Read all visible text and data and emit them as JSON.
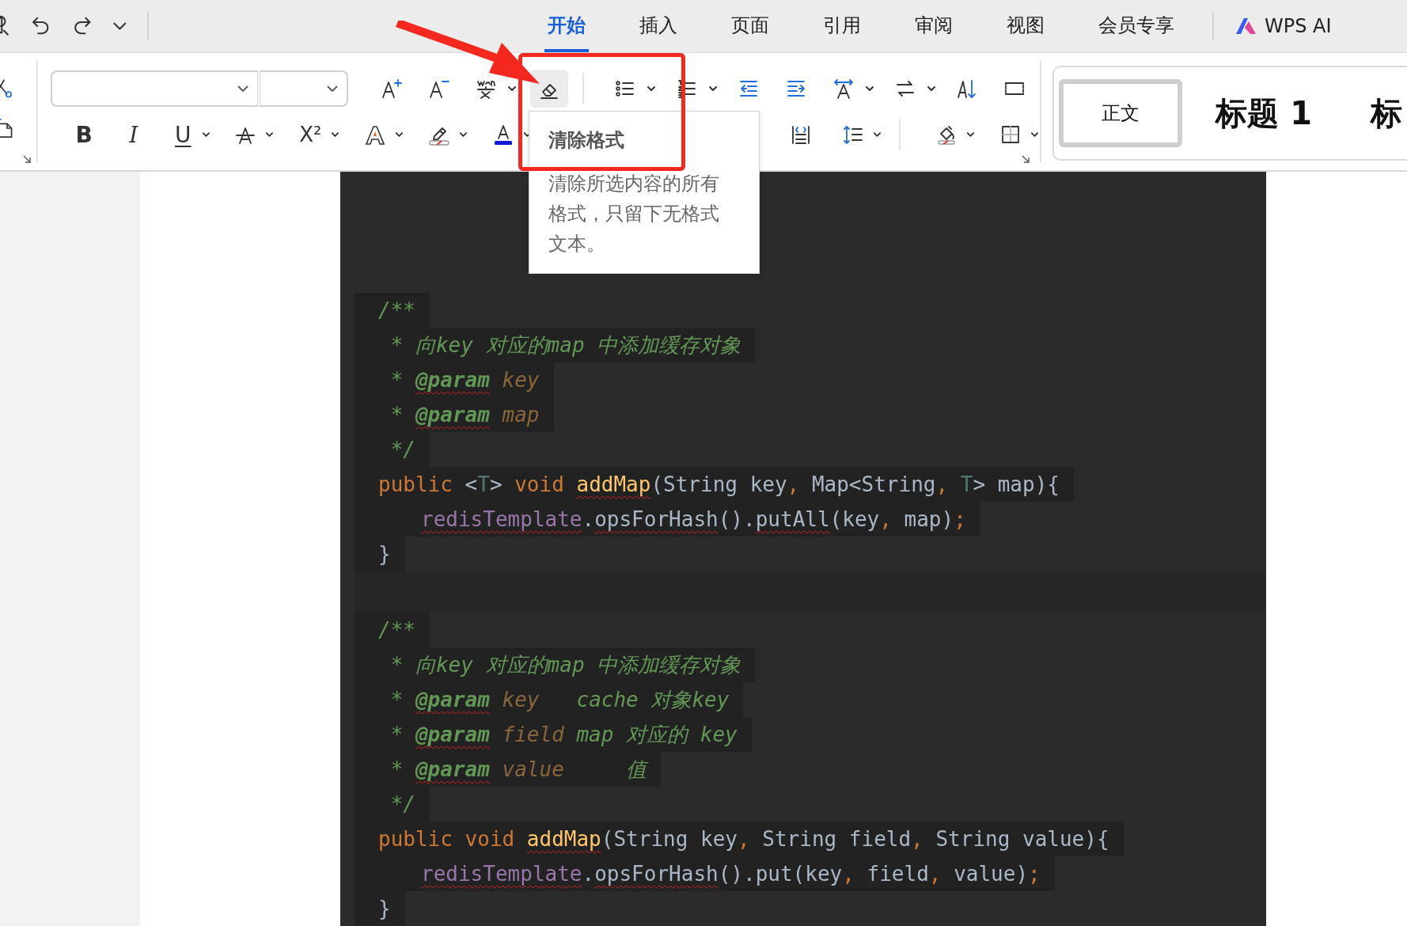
{
  "toolbar": {
    "tabs": [
      {
        "label": "开始",
        "selected": true
      },
      {
        "label": "插入",
        "selected": false
      },
      {
        "label": "页面",
        "selected": false
      },
      {
        "label": "引用",
        "selected": false
      },
      {
        "label": "审阅",
        "selected": false
      },
      {
        "label": "视图",
        "selected": false
      },
      {
        "label": "会员专享",
        "selected": false
      }
    ],
    "ai_label": "WPS AI"
  },
  "ribbon": {
    "glyph_buttons": [
      "B",
      "I",
      "U",
      "X²"
    ],
    "styles": [
      {
        "label": "正文",
        "selected": true
      },
      {
        "label": "标题 1",
        "selected": false
      },
      {
        "label": "标",
        "selected": false
      }
    ]
  },
  "tooltip": {
    "title": "清除格式",
    "body": "清除所选内容的所有格式，只留下无格式文本。"
  },
  "code_blocks": [
    {
      "lines": [
        {
          "indented": false,
          "tokens": [
            {
              "text": "/**",
              "kind": "comment",
              "flagged": false
            }
          ]
        },
        {
          "indented": false,
          "tokens": [
            {
              "text": " * 向key 对应的map 中添加缓存对象",
              "kind": "comment",
              "flagged": false
            }
          ]
        },
        {
          "indented": false,
          "tokens": [
            {
              "text": " * ",
              "kind": "comment",
              "flagged": false
            },
            {
              "text": "@param",
              "kind": "tag",
              "flagged": true
            },
            {
              "text": " key",
              "kind": "param",
              "flagged": false
            }
          ]
        },
        {
          "indented": false,
          "tokens": [
            {
              "text": " * ",
              "kind": "comment",
              "flagged": false
            },
            {
              "text": "@param",
              "kind": "tag",
              "flagged": true
            },
            {
              "text": " map",
              "kind": "param",
              "flagged": false
            }
          ]
        },
        {
          "indented": false,
          "tokens": [
            {
              "text": " */",
              "kind": "comment",
              "flagged": false
            }
          ]
        },
        {
          "indented": false,
          "tokens": [
            {
              "text": "public",
              "kind": "keyword",
              "flagged": false
            },
            {
              "text": " <",
              "kind": "plain",
              "flagged": false
            },
            {
              "text": "T",
              "kind": "typeparam",
              "flagged": false
            },
            {
              "text": "> ",
              "kind": "plain",
              "flagged": false
            },
            {
              "text": "void ",
              "kind": "keyword",
              "flagged": false
            },
            {
              "text": "addMap",
              "kind": "method",
              "flagged": true
            },
            {
              "text": "(String key",
              "kind": "plain",
              "flagged": false
            },
            {
              "text": ",",
              "kind": "punct",
              "flagged": false
            },
            {
              "text": " Map<String",
              "kind": "plain",
              "flagged": false
            },
            {
              "text": ", ",
              "kind": "punct",
              "flagged": false
            },
            {
              "text": "T",
              "kind": "typeparam",
              "flagged": false
            },
            {
              "text": "> map){",
              "kind": "plain",
              "flagged": false
            }
          ]
        },
        {
          "indented": true,
          "tokens": [
            {
              "text": "redisTemplate",
              "kind": "field",
              "flagged": true
            },
            {
              "text": ".",
              "kind": "plain",
              "flagged": false
            },
            {
              "text": "opsForHash",
              "kind": "plain",
              "flagged": true
            },
            {
              "text": "().",
              "kind": "plain",
              "flagged": false
            },
            {
              "text": "putAll",
              "kind": "plain",
              "flagged": true
            },
            {
              "text": "(key",
              "kind": "plain",
              "flagged": false
            },
            {
              "text": ",",
              "kind": "punct",
              "flagged": false
            },
            {
              "text": " map)",
              "kind": "plain",
              "flagged": false
            },
            {
              "text": ";",
              "kind": "punct",
              "flagged": false
            }
          ]
        },
        {
          "indented": false,
          "tokens": [
            {
              "text": "}",
              "kind": "plain",
              "flagged": false
            }
          ]
        }
      ]
    },
    {
      "lines": [
        {
          "indented": false,
          "tokens": [
            {
              "text": "/**",
              "kind": "comment",
              "flagged": false
            }
          ]
        },
        {
          "indented": false,
          "tokens": [
            {
              "text": " * 向key 对应的map 中添加缓存对象",
              "kind": "comment",
              "flagged": false
            }
          ]
        },
        {
          "indented": false,
          "tokens": [
            {
              "text": " * ",
              "kind": "comment",
              "flagged": false
            },
            {
              "text": "@param",
              "kind": "tag",
              "flagged": true
            },
            {
              "text": " key",
              "kind": "param",
              "flagged": false
            },
            {
              "text": "   cache 对象key",
              "kind": "comment",
              "flagged": false
            }
          ]
        },
        {
          "indented": false,
          "tokens": [
            {
              "text": " * ",
              "kind": "comment",
              "flagged": false
            },
            {
              "text": "@param",
              "kind": "tag",
              "flagged": true
            },
            {
              "text": " field",
              "kind": "param",
              "flagged": false
            },
            {
              "text": " map 对应的 key",
              "kind": "comment",
              "flagged": false
            }
          ]
        },
        {
          "indented": false,
          "tokens": [
            {
              "text": " * ",
              "kind": "comment",
              "flagged": false
            },
            {
              "text": "@param",
              "kind": "tag",
              "flagged": true
            },
            {
              "text": " value",
              "kind": "param",
              "flagged": false
            },
            {
              "text": "     值",
              "kind": "comment",
              "flagged": false
            }
          ]
        },
        {
          "indented": false,
          "tokens": [
            {
              "text": " */",
              "kind": "comment",
              "flagged": false
            }
          ]
        },
        {
          "indented": false,
          "tokens": [
            {
              "text": "public void ",
              "kind": "keyword",
              "flagged": false
            },
            {
              "text": "addMap",
              "kind": "method",
              "flagged": true
            },
            {
              "text": "(String key",
              "kind": "plain",
              "flagged": false
            },
            {
              "text": ",",
              "kind": "punct",
              "flagged": false
            },
            {
              "text": " String field",
              "kind": "plain",
              "flagged": false
            },
            {
              "text": ",",
              "kind": "punct",
              "flagged": false
            },
            {
              "text": " String value){",
              "kind": "plain",
              "flagged": false
            }
          ]
        },
        {
          "indented": true,
          "tokens": [
            {
              "text": "redisTemplate",
              "kind": "field",
              "flagged": true
            },
            {
              "text": ".",
              "kind": "plain",
              "flagged": false
            },
            {
              "text": "opsForHash",
              "kind": "plain",
              "flagged": true
            },
            {
              "text": "().put(key",
              "kind": "plain",
              "flagged": false
            },
            {
              "text": ",",
              "kind": "punct",
              "flagged": false
            },
            {
              "text": " field",
              "kind": "plain",
              "flagged": false
            },
            {
              "text": ",",
              "kind": "punct",
              "flagged": false
            },
            {
              "text": " value)",
              "kind": "plain",
              "flagged": false
            },
            {
              "text": ";",
              "kind": "punct",
              "flagged": false
            }
          ]
        },
        {
          "indented": false,
          "tokens": [
            {
              "text": "}",
              "kind": "plain",
              "flagged": false
            }
          ]
        }
      ]
    }
  ]
}
